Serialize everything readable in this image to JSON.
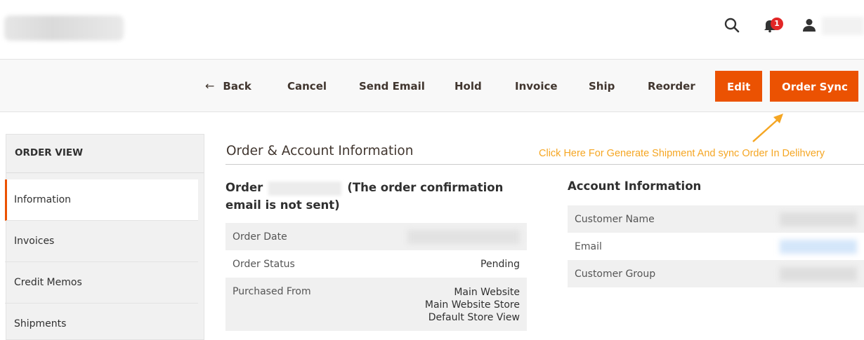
{
  "header": {
    "notification_count": "1",
    "icons": [
      "search-icon",
      "bell-icon",
      "user-icon"
    ]
  },
  "toolbar": {
    "back_label": "Back",
    "cancel_label": "Cancel",
    "send_email_label": "Send Email",
    "hold_label": "Hold",
    "invoice_label": "Invoice",
    "ship_label": "Ship",
    "reorder_label": "Reorder",
    "edit_label": "Edit",
    "order_sync_label": "Order Sync",
    "accent_color": "#eb5202"
  },
  "callout": {
    "text": "Click Here For Generate Shipment And sync Order In Delihvery",
    "color": "#f5a623"
  },
  "sidebar": {
    "title": "ORDER VIEW",
    "items": [
      {
        "label": "Information",
        "active": true
      },
      {
        "label": "Invoices",
        "active": false
      },
      {
        "label": "Credit Memos",
        "active": false
      },
      {
        "label": "Shipments",
        "active": false
      }
    ]
  },
  "main": {
    "section_title": "Order & Account Information",
    "order": {
      "prefix": "Order",
      "suffix": "(The order confirmation email is not sent)",
      "rows": {
        "order_date_label": "Order Date",
        "order_status_label": "Order Status",
        "order_status_value": "Pending",
        "purchased_from_label": "Purchased From",
        "purchased_from_lines": [
          "Main Website",
          "Main Website Store",
          "Default Store View"
        ]
      }
    },
    "account": {
      "title": "Account Information",
      "customer_name_label": "Customer Name",
      "email_label": "Email",
      "customer_group_label": "Customer Group"
    }
  }
}
